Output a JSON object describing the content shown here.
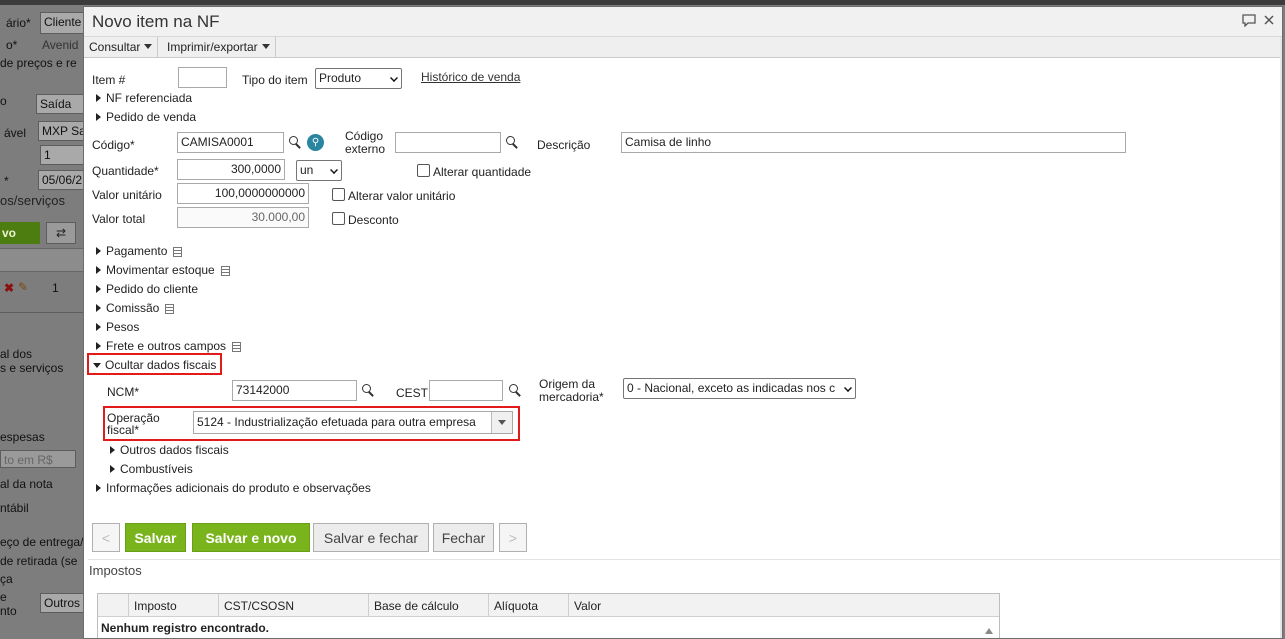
{
  "background": {
    "labels": [
      "ário*",
      "o*",
      "de preços e re",
      "o",
      "ável",
      "*",
      "os/serviços",
      "al dos",
      "s e serviços",
      "espesas",
      "al da nota",
      "ntábil",
      "eço de entrega/",
      "de retirada (se",
      "ça",
      "e",
      "nto"
    ],
    "fields": [
      "Cliente",
      "Avenid",
      "Saída",
      "MXP Sa",
      "1",
      "05/06/2",
      "Outros",
      "to em R$"
    ],
    "green_button": "vo",
    "grid_value": "1"
  },
  "modal": {
    "title": "Novo item na NF",
    "toolbar": {
      "consultar": "Consultar",
      "imprimir": "Imprimir/exportar"
    },
    "item_label": "Item #",
    "item_value": "",
    "tipo_label": "Tipo do item",
    "tipo_value": "Produto",
    "historico_link": "Histórico de venda",
    "nf_referenciada": "NF referenciada",
    "pedido_venda": "Pedido de venda",
    "codigo_label": "Código*",
    "codigo_value": "CAMISA0001",
    "codigo_externo_label": "Código externo",
    "codigo_externo_value": "",
    "descricao_label": "Descrição",
    "descricao_value": "Camisa de linho",
    "quantidade_label": "Quantidade*",
    "quantidade_value": "300,0000",
    "unidade_value": "un",
    "alterar_quantidade": "Alterar quantidade",
    "valor_unitario_label": "Valor unitário",
    "valor_unitario_value": "100,0000000000",
    "alterar_valor_unitario": "Alterar valor unitário",
    "valor_total_label": "Valor total",
    "valor_total_value": "30.000,00",
    "desconto": "Desconto",
    "sections": {
      "pagamento": "Pagamento",
      "movimentar_estoque": "Movimentar estoque",
      "pedido_cliente": "Pedido do cliente",
      "comissao": "Comissão",
      "pesos": "Pesos",
      "frete": "Frete e outros campos",
      "ocultar_fiscais": "Ocultar dados fiscais",
      "outros_fiscais": "Outros dados fiscais",
      "combustiveis": "Combustíveis",
      "info_adicionais": "Informações adicionais do produto e observações"
    },
    "ncm_label": "NCM*",
    "ncm_value": "73142000",
    "cest_label": "CEST",
    "cest_value": "",
    "origem_label": "Origem da mercadoria*",
    "origem_value": "0 - Nacional, exceto as indicadas nos c",
    "operacao_label": "Operação fiscal*",
    "operacao_value": "5124 - Industrialização efetuada para outra empresa",
    "buttons": {
      "prev": "<",
      "salvar": "Salvar",
      "salvar_novo": "Salvar e novo",
      "salvar_fechar": "Salvar e fechar",
      "fechar": "Fechar",
      "next": ">"
    },
    "impostos_title": "Impostos",
    "impostos_columns": [
      "Imposto",
      "CST/CSOSN",
      "Base de cálculo",
      "Alíquota",
      "Valor"
    ],
    "impostos_empty": "Nenhum registro encontrado."
  },
  "colors": {
    "accent_green": "#7ab41d",
    "highlight_red": "#e21a1a"
  }
}
